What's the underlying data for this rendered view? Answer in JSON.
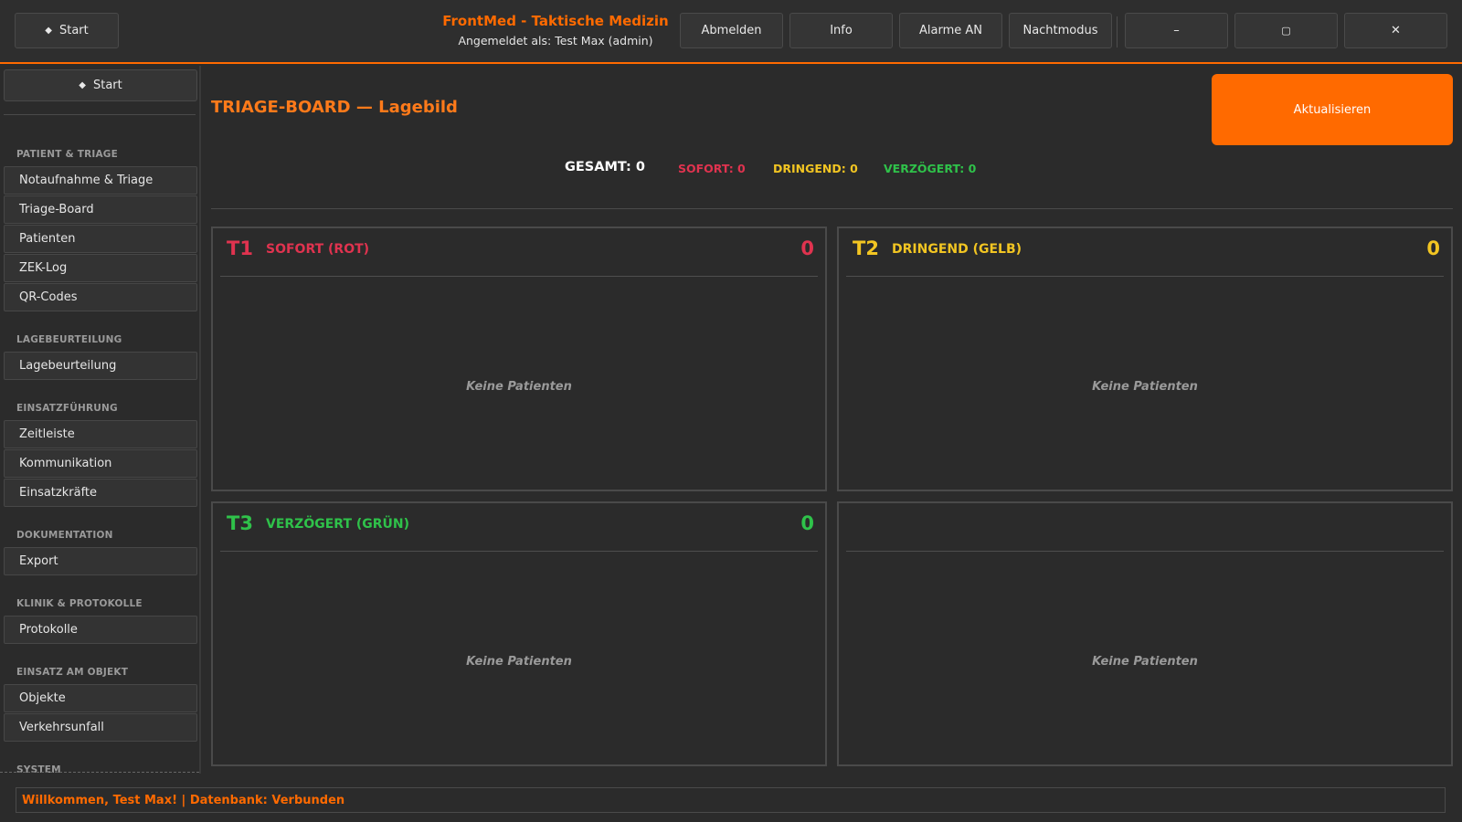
{
  "header": {
    "start_label": "Start",
    "app_title": "FrontMed - Taktische Medizin",
    "user_line": "Angemeldet als: Test Max (admin)",
    "buttons": {
      "logout": "Abmelden",
      "info": "Info",
      "alarms": "Alarme AN",
      "night_mode": "Nachtmodus",
      "minimize": "–",
      "maximize": "▢",
      "close": "✕"
    }
  },
  "sidebar": {
    "start_label": "Start",
    "sections": [
      {
        "title": "PATIENT & TRIAGE",
        "items": [
          "Notaufnahme & Triage",
          "Triage-Board",
          "Patienten",
          "ZEK-Log",
          "QR-Codes"
        ]
      },
      {
        "title": "LAGEBEURTEILUNG",
        "items": [
          "Lagebeurteilung"
        ]
      },
      {
        "title": "EINSATZFÜHRUNG",
        "items": [
          "Zeitleiste",
          "Kommunikation",
          "Einsatzkräfte"
        ]
      },
      {
        "title": "DOKUMENTATION",
        "items": [
          "Export"
        ]
      },
      {
        "title": "KLINIK & PROTOKOLLE",
        "items": [
          "Protokolle"
        ]
      },
      {
        "title": "EINSATZ AM OBJEKT",
        "items": [
          "Objekte",
          "Verkehrsunfall"
        ]
      },
      {
        "title": "SYSTEM",
        "items": []
      }
    ]
  },
  "main": {
    "title": "TRIAGE-BOARD — Lagebild",
    "refresh_label": "Aktualisieren",
    "stats": {
      "total": "GESAMT: 0",
      "immediate": "SOFORT: 0",
      "urgent": "DRINGEND: 0",
      "delayed": "VERZÖGERT: 0"
    },
    "panels": [
      {
        "code": "T1",
        "name": "SOFORT (ROT)",
        "count": "0",
        "empty": "Keine Patienten",
        "color": "#e0334f"
      },
      {
        "code": "T2",
        "name": "DRINGEND (GELB)",
        "count": "0",
        "empty": "Keine Patienten",
        "color": "#f2c522"
      },
      {
        "code": "T3",
        "name": "VERZÖGERT (GRÜN)",
        "count": "0",
        "empty": "Keine Patienten",
        "color": "#2fc24a"
      },
      {
        "code": "",
        "name": "",
        "count": "",
        "empty": "Keine Patienten",
        "color": "#3a3a3a"
      }
    ]
  },
  "status_bar": {
    "text": "Willkommen, Test Max! | Datenbank: Verbunden"
  },
  "colors": {
    "accent": "#ff6a00",
    "background": "#2b2b2b"
  }
}
